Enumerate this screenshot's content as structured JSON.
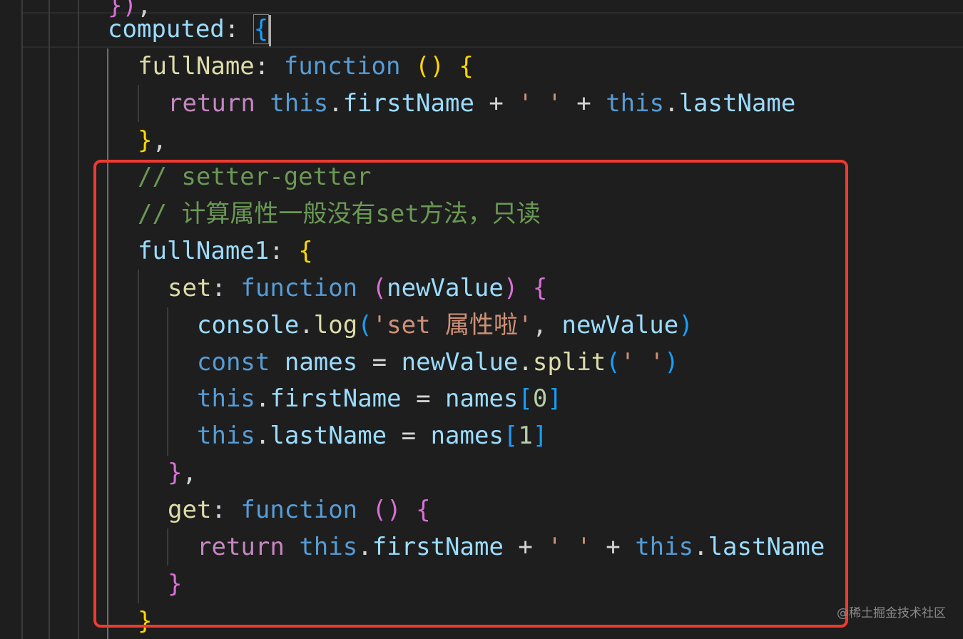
{
  "editor": {
    "lines": [
      {
        "tokens": [
          {
            "t": "})",
            "c": "b2"
          },
          {
            "t": ",",
            "c": "plain"
          }
        ]
      },
      {
        "tokens": [
          {
            "t": "computed",
            "c": "prop"
          },
          {
            "t": ": ",
            "c": "plain"
          },
          {
            "t": "{",
            "c": "b3"
          }
        ]
      },
      {
        "tokens": [
          {
            "t": "fullName",
            "c": "func"
          },
          {
            "t": ": ",
            "c": "plain"
          },
          {
            "t": "function",
            "c": "kw-blue"
          },
          {
            "t": " ",
            "c": "plain"
          },
          {
            "t": "()",
            "c": "b1"
          },
          {
            "t": " ",
            "c": "plain"
          },
          {
            "t": "{",
            "c": "b1"
          }
        ]
      },
      {
        "tokens": [
          {
            "t": "return",
            "c": "kw-purple"
          },
          {
            "t": " ",
            "c": "plain"
          },
          {
            "t": "this",
            "c": "kw-blue"
          },
          {
            "t": ".",
            "c": "plain"
          },
          {
            "t": "firstName",
            "c": "prop"
          },
          {
            "t": " + ",
            "c": "plain"
          },
          {
            "t": "' '",
            "c": "str"
          },
          {
            "t": " + ",
            "c": "plain"
          },
          {
            "t": "this",
            "c": "kw-blue"
          },
          {
            "t": ".",
            "c": "plain"
          },
          {
            "t": "lastName",
            "c": "prop"
          }
        ]
      },
      {
        "tokens": [
          {
            "t": "}",
            "c": "b1"
          },
          {
            "t": ",",
            "c": "plain"
          }
        ]
      },
      {
        "tokens": [
          {
            "t": "// setter-getter",
            "c": "cmt"
          }
        ]
      },
      {
        "tokens": [
          {
            "t": "// 计算属性一般没有set方法，只读",
            "c": "cmt"
          }
        ]
      },
      {
        "tokens": [
          {
            "t": "fullName1",
            "c": "prop"
          },
          {
            "t": ": ",
            "c": "plain"
          },
          {
            "t": "{",
            "c": "b1"
          }
        ]
      },
      {
        "tokens": [
          {
            "t": "set",
            "c": "func"
          },
          {
            "t": ": ",
            "c": "plain"
          },
          {
            "t": "function",
            "c": "kw-blue"
          },
          {
            "t": " ",
            "c": "plain"
          },
          {
            "t": "(",
            "c": "b2"
          },
          {
            "t": "newValue",
            "c": "prop"
          },
          {
            "t": ")",
            "c": "b2"
          },
          {
            "t": " ",
            "c": "plain"
          },
          {
            "t": "{",
            "c": "b2"
          }
        ]
      },
      {
        "tokens": [
          {
            "t": "console",
            "c": "prop"
          },
          {
            "t": ".",
            "c": "plain"
          },
          {
            "t": "log",
            "c": "func"
          },
          {
            "t": "(",
            "c": "b3"
          },
          {
            "t": "'set 属性啦'",
            "c": "str"
          },
          {
            "t": ", ",
            "c": "plain"
          },
          {
            "t": "newValue",
            "c": "prop"
          },
          {
            "t": ")",
            "c": "b3"
          }
        ]
      },
      {
        "tokens": [
          {
            "t": "const",
            "c": "kw-blue"
          },
          {
            "t": " ",
            "c": "plain"
          },
          {
            "t": "names",
            "c": "prop"
          },
          {
            "t": " = ",
            "c": "plain"
          },
          {
            "t": "newValue",
            "c": "prop"
          },
          {
            "t": ".",
            "c": "plain"
          },
          {
            "t": "split",
            "c": "func"
          },
          {
            "t": "(",
            "c": "b3"
          },
          {
            "t": "' '",
            "c": "str"
          },
          {
            "t": ")",
            "c": "b3"
          }
        ]
      },
      {
        "tokens": [
          {
            "t": "this",
            "c": "kw-blue"
          },
          {
            "t": ".",
            "c": "plain"
          },
          {
            "t": "firstName",
            "c": "prop"
          },
          {
            "t": " = ",
            "c": "plain"
          },
          {
            "t": "names",
            "c": "prop"
          },
          {
            "t": "[",
            "c": "b3"
          },
          {
            "t": "0",
            "c": "num"
          },
          {
            "t": "]",
            "c": "b3"
          }
        ]
      },
      {
        "tokens": [
          {
            "t": "this",
            "c": "kw-blue"
          },
          {
            "t": ".",
            "c": "plain"
          },
          {
            "t": "lastName",
            "c": "prop"
          },
          {
            "t": " = ",
            "c": "plain"
          },
          {
            "t": "names",
            "c": "prop"
          },
          {
            "t": "[",
            "c": "b3"
          },
          {
            "t": "1",
            "c": "num"
          },
          {
            "t": "]",
            "c": "b3"
          }
        ]
      },
      {
        "tokens": [
          {
            "t": "}",
            "c": "b2"
          },
          {
            "t": ",",
            "c": "plain"
          }
        ]
      },
      {
        "tokens": [
          {
            "t": "get",
            "c": "func"
          },
          {
            "t": ": ",
            "c": "plain"
          },
          {
            "t": "function",
            "c": "kw-blue"
          },
          {
            "t": " ",
            "c": "plain"
          },
          {
            "t": "()",
            "c": "b2"
          },
          {
            "t": " ",
            "c": "plain"
          },
          {
            "t": "{",
            "c": "b2"
          }
        ]
      },
      {
        "tokens": [
          {
            "t": "return",
            "c": "kw-purple"
          },
          {
            "t": " ",
            "c": "plain"
          },
          {
            "t": "this",
            "c": "kw-blue"
          },
          {
            "t": ".",
            "c": "plain"
          },
          {
            "t": "firstName",
            "c": "prop"
          },
          {
            "t": " + ",
            "c": "plain"
          },
          {
            "t": "' '",
            "c": "str"
          },
          {
            "t": " + ",
            "c": "plain"
          },
          {
            "t": "this",
            "c": "kw-blue"
          },
          {
            "t": ".",
            "c": "plain"
          },
          {
            "t": "lastName",
            "c": "prop"
          }
        ]
      },
      {
        "tokens": [
          {
            "t": "}",
            "c": "b2"
          }
        ]
      },
      {
        "tokens": [
          {
            "t": "}",
            "c": "b1"
          }
        ]
      }
    ]
  },
  "watermark": {
    "text": "@稀土掘金技术社区"
  },
  "colors": {
    "background": "#1e1e1e",
    "highlight_border": "#ee3b2f",
    "keyword": "#569cd6",
    "control_keyword": "#c586c0",
    "property": "#9cdcfe",
    "function": "#dcdcaa",
    "string": "#ce9178",
    "number": "#b5cea8",
    "comment": "#6a9955",
    "bracket_level_1": "#ffd700",
    "bracket_level_2": "#da70d6",
    "bracket_level_3": "#179fff"
  }
}
